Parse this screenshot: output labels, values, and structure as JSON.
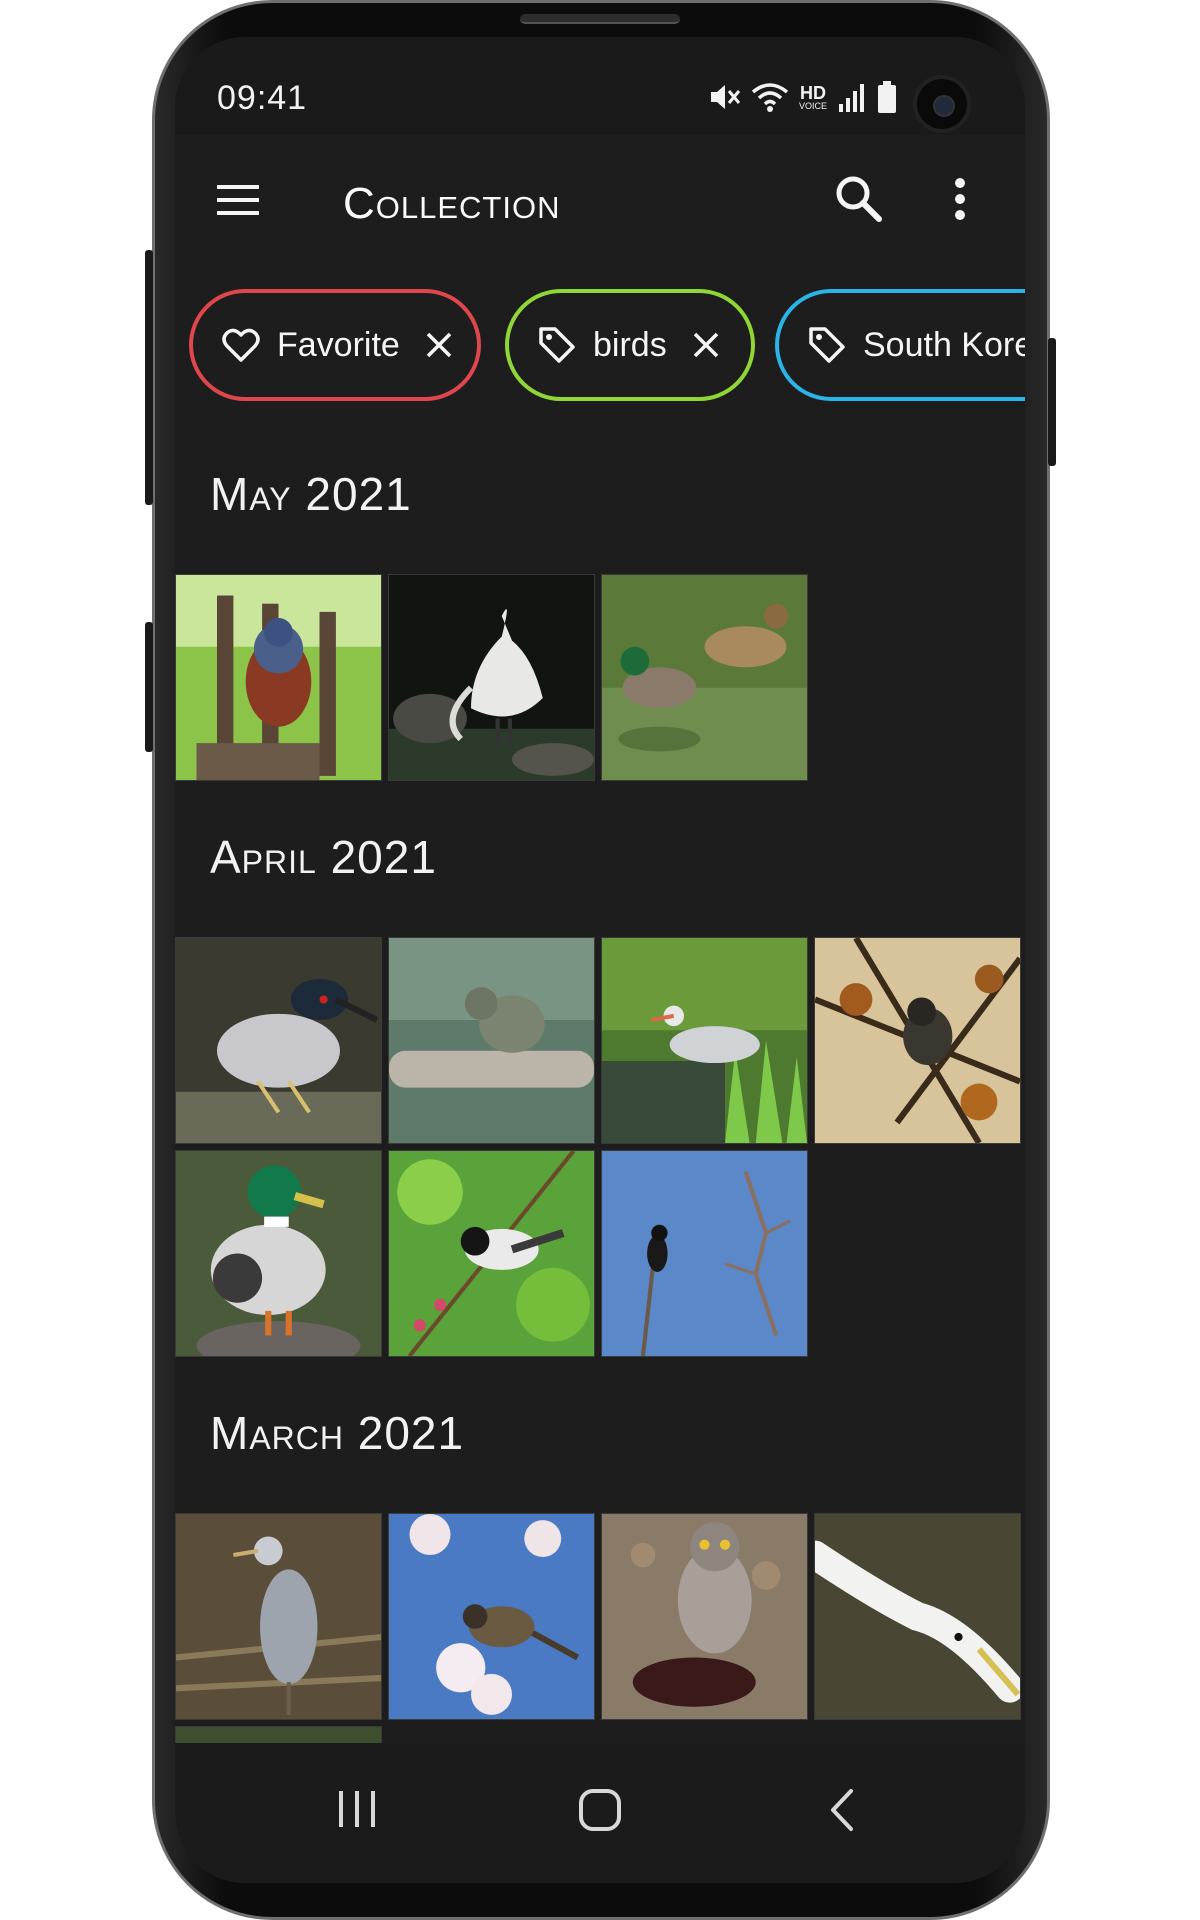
{
  "status_bar": {
    "time": "09:41",
    "icons": [
      "mute-icon",
      "wifi-icon",
      "hd-voice-icon",
      "signal-icon",
      "battery-icon"
    ],
    "hd_label": "HD",
    "voice_label": "VOICE"
  },
  "app_bar": {
    "title": "Collection",
    "menu_icon": "hamburger-menu-icon",
    "search_icon": "search-icon",
    "more_icon": "more-vertical-icon"
  },
  "chips": [
    {
      "label": "Favorite",
      "icon": "heart-icon",
      "color": "#e0474c",
      "closable": true
    },
    {
      "label": "birds",
      "icon": "tag-icon",
      "color": "#8fd636",
      "closable": true
    },
    {
      "label": "South Korea",
      "icon": "tag-icon",
      "color": "#2ab4e8",
      "closable": false
    }
  ],
  "sections": [
    {
      "title": "May 2021",
      "photo_count": 3
    },
    {
      "title": "April 2021",
      "photo_count": 7
    },
    {
      "title": "March 2021",
      "photo_count": 5
    }
  ],
  "photos": {
    "may": [
      {
        "subject": "blue rock thrush on fence post"
      },
      {
        "subject": "great egret on rocks"
      },
      {
        "subject": "mallard ducks on water"
      }
    ],
    "april": [
      {
        "subject": "black-crowned night heron"
      },
      {
        "subject": "bird on branch with prey"
      },
      {
        "subject": "grey heron in grass"
      },
      {
        "subject": "bird in autumn branches"
      },
      {
        "subject": "mallard drake on rock"
      },
      {
        "subject": "tit on flowering branch"
      },
      {
        "subject": "bird on twig against blue sky"
      }
    ],
    "march": [
      {
        "subject": "grey heron standing"
      },
      {
        "subject": "bulbul among cherry blossoms"
      },
      {
        "subject": "hawk on ground"
      },
      {
        "subject": "white egret close-up"
      },
      {
        "subject": "egret at water"
      }
    ]
  },
  "nav_bar": {
    "recent_icon": "recent-apps-icon",
    "home_icon": "home-icon",
    "back_icon": "back-icon"
  },
  "colors": {
    "background": "#1d1d1d",
    "text": "#f2f2f2"
  }
}
